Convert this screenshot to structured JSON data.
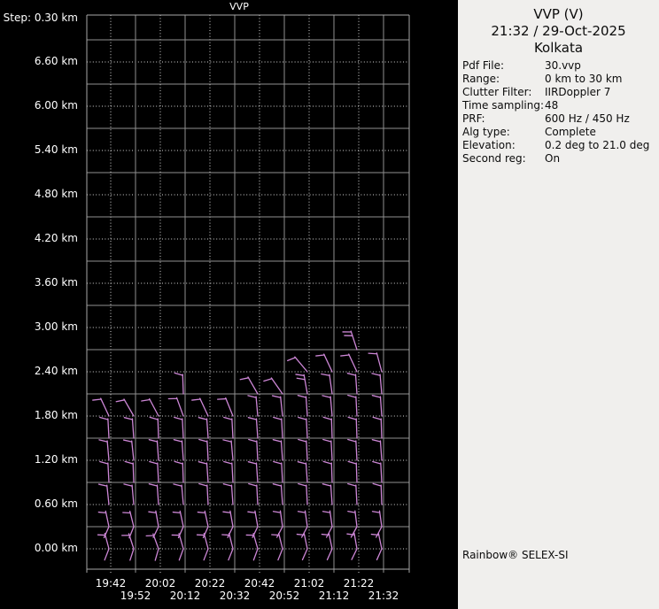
{
  "panel": {
    "title": "VVP (V)",
    "datetime": "21:32 / 29-Oct-2025",
    "site": "Kolkata",
    "fields": [
      {
        "label": "Pdf File:",
        "value": "30.vvp"
      },
      {
        "label": "Range:",
        "value": "0 km to 30 km"
      },
      {
        "label": "Clutter Filter:",
        "value": "IIRDoppler 7"
      },
      {
        "label": "Time sampling:",
        "value": "48"
      },
      {
        "label": "PRF:",
        "value": "600 Hz / 450 Hz"
      },
      {
        "label": "Alg type:",
        "value": "Complete"
      },
      {
        "label": "Elevation:",
        "value": "0.2 deg to 21.0 deg"
      },
      {
        "label": "Second reg:",
        "value": "On"
      }
    ],
    "brand": "Rainbow® SELEX-SI",
    "background_color": "#f0efed"
  },
  "chart_data": {
    "type": "wind-barb-time-height",
    "title": "VVP",
    "step_label": "Step: 0.30 km",
    "y_tick_labels": [
      "6.60 km",
      "6.00 km",
      "5.40 km",
      "4.80 km",
      "4.20 km",
      "3.60 km",
      "3.00 km",
      "2.40 km",
      "1.80 km",
      "1.20 km",
      "0.60 km",
      "0.00 km"
    ],
    "x_tick_labels_row1": [
      "19:42",
      "20:02",
      "20:22",
      "20:42",
      "21:02",
      "21:22"
    ],
    "x_tick_labels_row2": [
      "19:52",
      "20:12",
      "20:32",
      "20:52",
      "21:12",
      "21:32"
    ],
    "height_axis": {
      "min_km": 0.0,
      "max_km": 7.2,
      "step_km": 0.3
    },
    "time_axis": {
      "start": "19:42",
      "end": "21:32",
      "interval_min": 10
    },
    "grid": {
      "dotted_at": "0.60 km multiples and labeled times",
      "solid_at": "intermediate 0.30 km levels and times"
    },
    "colors": {
      "background": "#000000",
      "grid_solid": "#8f8f8f",
      "grid_dotted": "#d9d9d9",
      "frame": "#a8a8a8",
      "barb": "#cd87d6",
      "axis_text": "#ffffff"
    },
    "barb_tuple": "[height_km, staff_angle_deg, style:1=top-tick,2=tail,3=double-tick]",
    "columns": [
      {
        "time": "19:42",
        "barbs": [
          [
            1.8,
            -25,
            1
          ],
          [
            1.5,
            -3,
            1
          ],
          [
            1.2,
            -5,
            1
          ],
          [
            0.9,
            -3,
            1
          ],
          [
            0.6,
            -6,
            1
          ],
          [
            0.3,
            -12,
            2
          ],
          [
            0.0,
            -15,
            2
          ]
        ]
      },
      {
        "time": "19:52",
        "barbs": [
          [
            1.8,
            -30,
            1
          ],
          [
            1.5,
            -4,
            1
          ],
          [
            1.2,
            -6,
            1
          ],
          [
            0.9,
            -2,
            1
          ],
          [
            0.6,
            -5,
            1
          ],
          [
            0.3,
            -14,
            2
          ],
          [
            0.0,
            -18,
            2
          ]
        ]
      },
      {
        "time": "20:02",
        "barbs": [
          [
            1.8,
            -28,
            1
          ],
          [
            1.5,
            -2,
            1
          ],
          [
            1.2,
            -4,
            1
          ],
          [
            0.9,
            -3,
            1
          ],
          [
            0.6,
            -4,
            1
          ],
          [
            0.3,
            -10,
            2
          ],
          [
            0.0,
            -20,
            2
          ]
        ]
      },
      {
        "time": "20:12",
        "barbs": [
          [
            2.1,
            -2,
            1
          ],
          [
            1.8,
            -20,
            1
          ],
          [
            1.5,
            -3,
            1
          ],
          [
            1.2,
            -4,
            1
          ],
          [
            0.9,
            -2,
            1
          ],
          [
            0.6,
            -5,
            1
          ],
          [
            0.3,
            -12,
            2
          ],
          [
            0.0,
            -16,
            2
          ]
        ]
      },
      {
        "time": "20:22",
        "barbs": [
          [
            1.8,
            -25,
            1
          ],
          [
            1.5,
            -4,
            1
          ],
          [
            1.2,
            -3,
            1
          ],
          [
            0.9,
            -4,
            1
          ],
          [
            0.6,
            -3,
            1
          ],
          [
            0.3,
            -12,
            2
          ],
          [
            0.0,
            -15,
            2
          ]
        ]
      },
      {
        "time": "20:32",
        "barbs": [
          [
            1.8,
            -22,
            1
          ],
          [
            1.5,
            -3,
            1
          ],
          [
            1.2,
            -5,
            1
          ],
          [
            0.9,
            -3,
            1
          ],
          [
            0.6,
            -4,
            1
          ],
          [
            0.3,
            -10,
            2
          ],
          [
            0.0,
            -14,
            2
          ]
        ]
      },
      {
        "time": "20:42",
        "barbs": [
          [
            2.1,
            -30,
            1
          ],
          [
            1.8,
            -5,
            1
          ],
          [
            1.5,
            -4,
            1
          ],
          [
            1.2,
            -3,
            1
          ],
          [
            0.9,
            -4,
            1
          ],
          [
            0.6,
            -3,
            1
          ],
          [
            0.3,
            -10,
            2
          ],
          [
            0.0,
            -16,
            2
          ]
        ]
      },
      {
        "time": "20:52",
        "barbs": [
          [
            2.1,
            -35,
            1
          ],
          [
            1.8,
            -6,
            1
          ],
          [
            1.5,
            -3,
            1
          ],
          [
            1.2,
            -4,
            1
          ],
          [
            0.9,
            -3,
            1
          ],
          [
            0.6,
            -4,
            1
          ],
          [
            0.3,
            -8,
            2
          ],
          [
            0.0,
            -14,
            2
          ]
        ]
      },
      {
        "time": "21:02",
        "barbs": [
          [
            2.4,
            -40,
            1
          ],
          [
            2.1,
            -10,
            3
          ],
          [
            1.8,
            -4,
            1
          ],
          [
            1.5,
            -3,
            1
          ],
          [
            1.2,
            -3,
            1
          ],
          [
            0.9,
            -4,
            1
          ],
          [
            0.6,
            -3,
            1
          ],
          [
            0.3,
            -8,
            2
          ],
          [
            0.0,
            -12,
            2
          ]
        ]
      },
      {
        "time": "21:12",
        "barbs": [
          [
            2.4,
            -25,
            1
          ],
          [
            2.1,
            -8,
            1
          ],
          [
            1.8,
            -5,
            1
          ],
          [
            1.5,
            -2,
            1
          ],
          [
            1.2,
            -3,
            1
          ],
          [
            0.9,
            -2,
            1
          ],
          [
            0.6,
            -4,
            1
          ],
          [
            0.3,
            -8,
            2
          ],
          [
            0.0,
            -12,
            2
          ]
        ]
      },
      {
        "time": "21:22",
        "barbs": [
          [
            2.7,
            -18,
            3
          ],
          [
            2.4,
            -25,
            1
          ],
          [
            2.1,
            -4,
            1
          ],
          [
            1.8,
            -3,
            1
          ],
          [
            1.5,
            -2,
            1
          ],
          [
            1.2,
            -3,
            1
          ],
          [
            0.9,
            -2,
            1
          ],
          [
            0.6,
            -3,
            1
          ],
          [
            0.3,
            -7,
            2
          ],
          [
            0.0,
            -10,
            2
          ]
        ]
      },
      {
        "time": "21:32",
        "barbs": [
          [
            2.4,
            -15,
            1
          ],
          [
            2.1,
            -5,
            1
          ],
          [
            1.8,
            -4,
            1
          ],
          [
            1.5,
            -2,
            1
          ],
          [
            1.2,
            -4,
            1
          ],
          [
            0.9,
            -3,
            1
          ],
          [
            0.6,
            -2,
            1
          ],
          [
            0.3,
            -8,
            2
          ],
          [
            0.0,
            -12,
            2
          ]
        ]
      }
    ]
  }
}
